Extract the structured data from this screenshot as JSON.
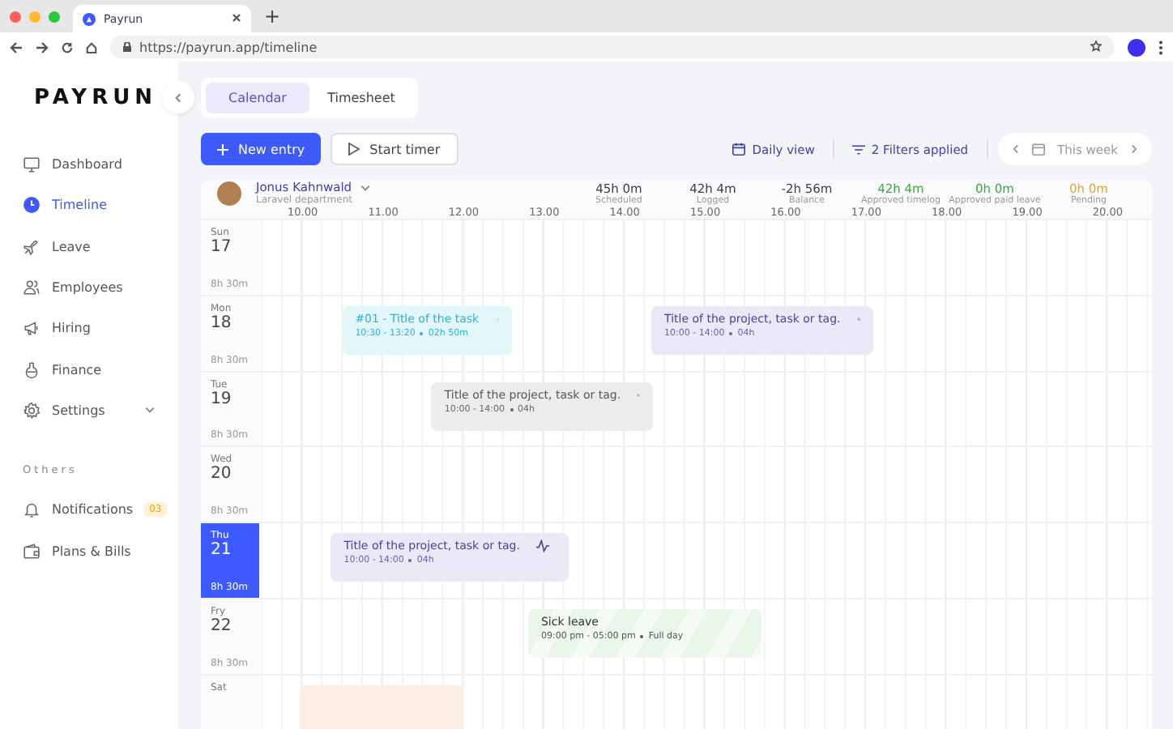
{
  "browser": {
    "tab_title": "Payrun",
    "new_tab": "+",
    "url": "https://payrun.app/timeline"
  },
  "sidebar": {
    "logo": "PAYRUN",
    "items": [
      {
        "label": "Dashboard",
        "selected": false
      },
      {
        "label": "Timeline",
        "selected": true
      },
      {
        "label": "Leave",
        "selected": false
      },
      {
        "label": "Employees",
        "selected": false
      },
      {
        "label": "Hiring",
        "selected": false
      },
      {
        "label": "Finance",
        "selected": false
      },
      {
        "label": "Settings",
        "selected": false,
        "expandable": true
      }
    ],
    "section": "Others",
    "others": [
      {
        "label": "Notifications",
        "selected": false,
        "badge": "03"
      },
      {
        "label": "Plans & Bills",
        "selected": false
      }
    ]
  },
  "view_tabs": [
    {
      "label": "Calendar",
      "selected": true
    },
    {
      "label": "Timesheet",
      "selected": false
    }
  ],
  "toolbar": {
    "new_entry": "New entry",
    "start_timer": "Start timer",
    "daily_view": "Daily view",
    "filters": "2 Filters applied",
    "period": "This week"
  },
  "user": {
    "name": "Jonus Kahnwald",
    "department": "Laravel department"
  },
  "stats": [
    {
      "value": "45h 0m",
      "label": "Scheduled",
      "color": "#3b3b4f"
    },
    {
      "value": "42h 4m",
      "label": "Logged",
      "color": "#3b3b4f"
    },
    {
      "value": "-2h 56m",
      "label": "Balance",
      "color": "#3b3b4f"
    },
    {
      "value": "42h 4m",
      "label": "Approved timelog",
      "color": "#3aa83a"
    },
    {
      "value": "0h 0m",
      "label": "Approved paid leave",
      "color": "#3aa83a"
    },
    {
      "value": "0h 0m",
      "label": "Pending",
      "color": "#f0a020"
    }
  ],
  "hours": [
    "10.00",
    "11.00",
    "12.00",
    "13.00",
    "14.00",
    "15.00",
    "16.00",
    "17.00",
    "18.00",
    "19.00",
    "20.00"
  ],
  "days": [
    {
      "weekday": "Sun",
      "date": "17",
      "total": "8h 30m",
      "selected": false
    },
    {
      "weekday": "Mon",
      "date": "18",
      "total": "8h 30m",
      "selected": false,
      "events": [
        {
          "kind": "task",
          "title": "#01 - Title of the task",
          "time": "10:30 - 13:20",
          "duration": "02h 50m"
        },
        {
          "kind": "project",
          "title": "Title of the project, task or tag.",
          "time": "10:00 - 14:00",
          "duration": "04h"
        }
      ]
    },
    {
      "weekday": "Tue",
      "date": "19",
      "total": "8h 30m",
      "selected": false,
      "events": [
        {
          "kind": "draft",
          "title": "Title of the project, task or tag.",
          "time": "10:00 - 14:00",
          "duration": "04h"
        }
      ]
    },
    {
      "weekday": "Wed",
      "date": "20",
      "total": "8h 30m",
      "selected": false
    },
    {
      "weekday": "Thu",
      "date": "21",
      "total": "8h 30m",
      "selected": true,
      "events": [
        {
          "kind": "project",
          "title": "Title of the project, task or tag.",
          "time": "10:00 - 14:00",
          "duration": "04h"
        }
      ]
    },
    {
      "weekday": "Fry",
      "date": "22",
      "total": "8h 30m",
      "selected": false,
      "events": [
        {
          "kind": "leave",
          "title": "Sick leave",
          "time": "09:00 pm - 05:00 pm",
          "duration": "Full day"
        }
      ]
    },
    {
      "weekday": "Sat",
      "selected": false,
      "events": [
        {
          "kind": "pending"
        }
      ]
    }
  ]
}
